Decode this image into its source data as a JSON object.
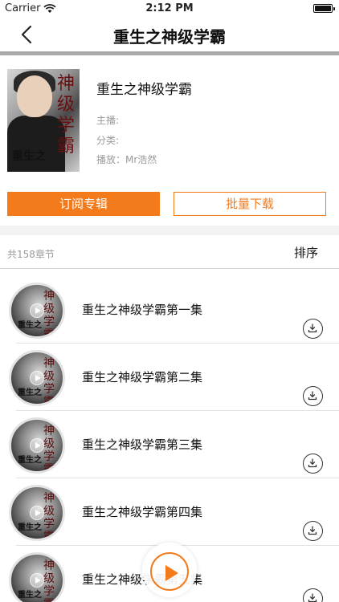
{
  "status_bar": {
    "carrier": "Carrier",
    "time": "2:12 PM"
  },
  "nav": {
    "title": "重生之神级学霸",
    "back_icon": "chevron-left-icon"
  },
  "album": {
    "title": "重生之神级学霸",
    "host_label": "主播:",
    "category_label": "分类:",
    "narrator_label": "播放：Mr浩然",
    "cover_text": "重生之",
    "cover_calligraphy": "神级学霸"
  },
  "actions": {
    "subscribe_label": "订阅专辑",
    "batch_download_label": "批量下载"
  },
  "list": {
    "chapter_count": "共158章节",
    "sort_label": "排序",
    "episodes": [
      {
        "title": "重生之神级学霸第一集"
      },
      {
        "title": "重生之神级学霸第二集"
      },
      {
        "title": "重生之神级学霸第三集"
      },
      {
        "title": "重生之神级学霸第四集"
      },
      {
        "title": "重生之神级学霸第五集"
      }
    ]
  },
  "colors": {
    "accent": "#f47b1c",
    "separator": "#a9a9a9"
  }
}
